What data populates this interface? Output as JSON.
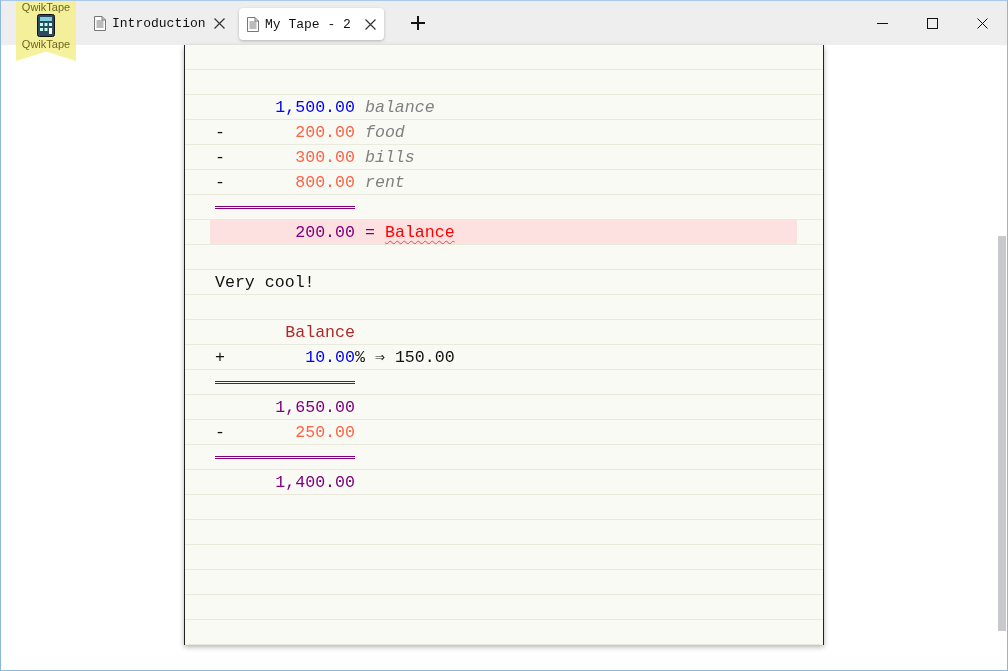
{
  "ribbon": {
    "lines": [
      "QwikTape",
      "QwikTape"
    ]
  },
  "tabs": [
    {
      "label": "Introduction",
      "selected": false
    },
    {
      "label": "My Tape - 2",
      "selected": true
    }
  ],
  "tape": {
    "rows": [
      {
        "kind": "blank"
      },
      {
        "kind": "blank"
      },
      {
        "kind": "entry",
        "op": "",
        "amount": "1,500.00",
        "color": "#0000ff",
        "comment": "balance"
      },
      {
        "kind": "entry",
        "op": "-",
        "amount": "200.00",
        "color": "#ff6347",
        "comment": "food"
      },
      {
        "kind": "entry",
        "op": "-",
        "amount": "300.00",
        "color": "#ff6347",
        "comment": "bills"
      },
      {
        "kind": "entry",
        "op": "-",
        "amount": "800.00",
        "color": "#ff6347",
        "comment": "rent"
      },
      {
        "kind": "rule",
        "color": "#800080"
      },
      {
        "kind": "result",
        "amount": "200.00",
        "color": "#800080",
        "equals": "=",
        "reference": "Balance",
        "spell_error": true,
        "highlighted": true
      },
      {
        "kind": "blank"
      },
      {
        "kind": "note",
        "text": "Very cool!"
      },
      {
        "kind": "blank"
      },
      {
        "kind": "label",
        "text": "Balance"
      },
      {
        "kind": "percent",
        "op": "+",
        "amount": "10.00",
        "color": "#0000ff",
        "suffix": "%",
        "result": "⇒ 150.00"
      },
      {
        "kind": "rule",
        "color": "#800080"
      },
      {
        "kind": "entry",
        "op": "",
        "amount": "1,650.00",
        "color": "#800080",
        "comment": ""
      },
      {
        "kind": "entry",
        "op": "-",
        "amount": "250.00",
        "color": "#ff6347",
        "comment": ""
      },
      {
        "kind": "rule",
        "color": "#800080"
      },
      {
        "kind": "entry",
        "op": "",
        "amount": "1,400.00",
        "color": "#800080",
        "comment": ""
      },
      {
        "kind": "blank"
      },
      {
        "kind": "blank"
      },
      {
        "kind": "blank"
      },
      {
        "kind": "blank"
      },
      {
        "kind": "blank"
      },
      {
        "kind": "blank"
      }
    ]
  }
}
